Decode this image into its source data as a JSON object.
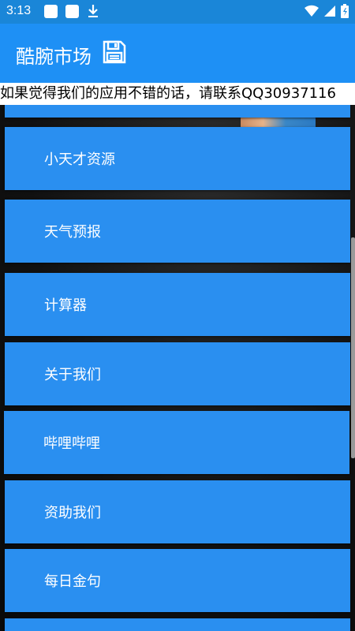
{
  "status_bar": {
    "time": "3:13",
    "icons": [
      "notification-square-icon",
      "notification-square-icon",
      "download-icon",
      "wifi-icon",
      "cell-signal-icon",
      "battery-icon"
    ]
  },
  "app_bar": {
    "title": "酷腕市场",
    "icon": "save-icon",
    "color": "#1e90f5"
  },
  "marquee": {
    "text": "如果觉得我们的应用不错的话，请联系QQ30937116"
  },
  "menu": {
    "items": [
      {
        "label": "小天才资源"
      },
      {
        "label": "天气预报"
      },
      {
        "label": "计算器"
      },
      {
        "label": "关于我们"
      },
      {
        "label": "哔哩哔哩"
      },
      {
        "label": "资助我们"
      },
      {
        "label": "每日金句"
      }
    ],
    "button_color": "#2a8ff0"
  }
}
